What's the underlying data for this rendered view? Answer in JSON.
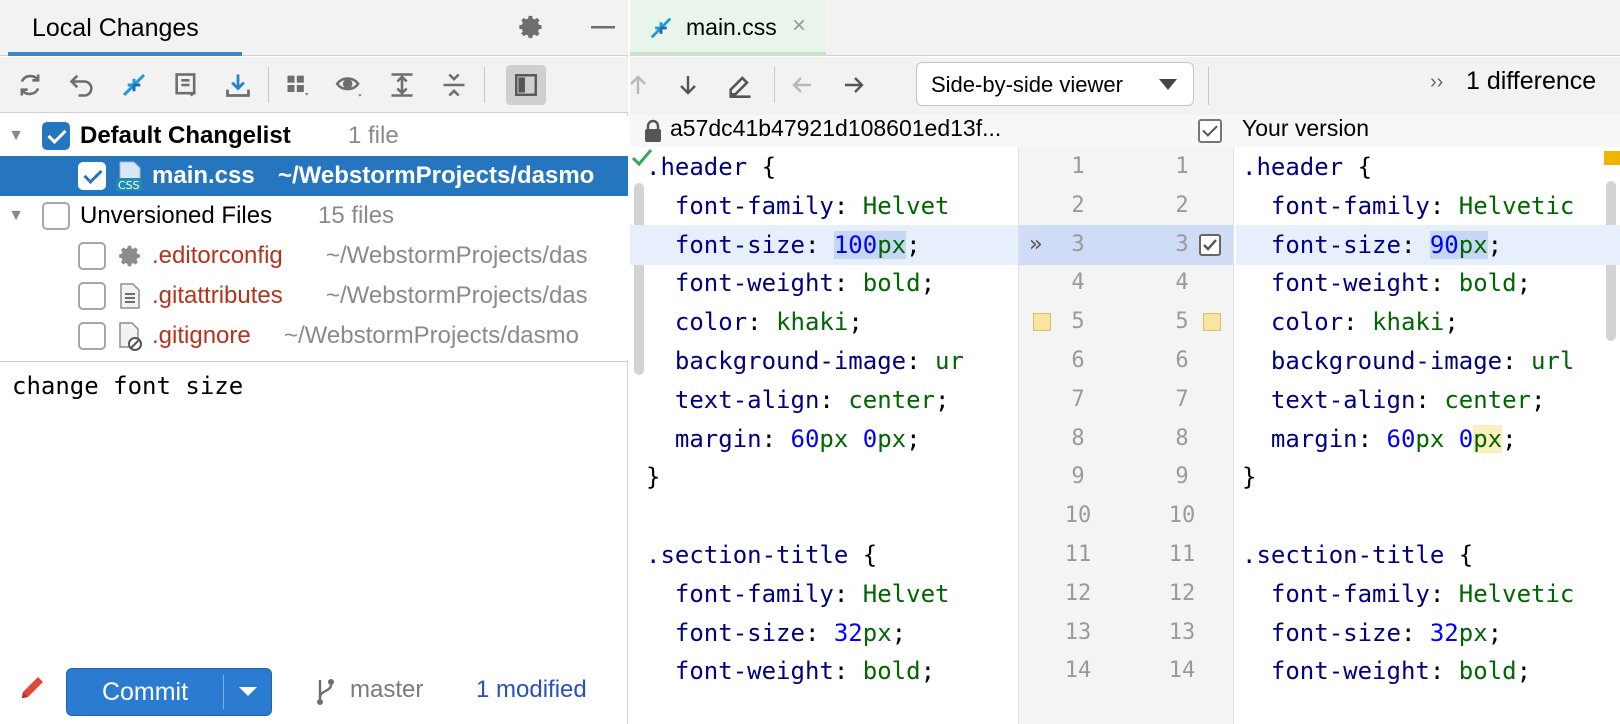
{
  "left_panel": {
    "title": "Local Changes",
    "header_icons": [
      "gear-icon",
      "minimize-icon"
    ],
    "toolbar": [
      "refresh-icon",
      "rollback-icon",
      "diff-icon",
      "shelve-icon",
      "update-icon",
      "group-by-icon",
      "view-options-icon",
      "expand-all-icon",
      "collapse-all-icon",
      "preview-toggle-icon"
    ],
    "tree": {
      "default": {
        "label": "Default Changelist",
        "count": "1 file",
        "checked": true
      },
      "default_files": [
        {
          "name": "main.css",
          "path": "~/WebstormProjects/dasmo",
          "checked": true,
          "selected": true
        }
      ],
      "unversioned": {
        "label": "Unversioned Files",
        "count": "15 files",
        "checked": false
      },
      "unversioned_files": [
        {
          "name": ".editorconfig",
          "path": "~/WebstormProjects/das",
          "icon": "gear-file-icon"
        },
        {
          "name": ".gitattributes",
          "path": "~/WebstormProjects/das",
          "icon": "text-file-icon"
        },
        {
          "name": ".gitignore",
          "path": "~/WebstormProjects/dasmo",
          "icon": "ignore-file-icon"
        }
      ]
    },
    "commit_message": "change font size",
    "commit_button": "Commit",
    "branch": "master",
    "modified": "1 modified"
  },
  "diff": {
    "tab": {
      "label": "main.css",
      "close": "×"
    },
    "viewer_mode": "Side-by-side viewer",
    "differences_chevron": "››",
    "differences": "1 difference",
    "left_revision": "a57dc41b47921d108601ed13f...",
    "right_title": "Your version",
    "left_lines": [
      ".header {",
      "  font-family: Helvet",
      "  font-size: 100px;",
      "  font-weight: bold;",
      "  color: khaki;",
      "  background-image: ur",
      "  text-align: center;",
      "  margin: 60px 0px;",
      "}",
      "",
      ".section-title {",
      "  font-family: Helvet",
      "  font-size: 32px;",
      "  font-weight: bold;"
    ],
    "right_lines": [
      ".header {",
      "  font-family: Helvetic",
      "  font-size: 90px;",
      "  font-weight: bold;",
      "  color: khaki;",
      "  background-image: url",
      "  text-align: center;",
      "  margin: 60px 0px;",
      "}",
      "",
      ".section-title {",
      "  font-family: Helvetic",
      "  font-size: 32px;",
      "  font-weight: bold;"
    ],
    "line_numbers": [
      "1",
      "2",
      "3",
      "4",
      "5",
      "6",
      "7",
      "8",
      "9",
      "10",
      "11",
      "12",
      "13",
      "14"
    ],
    "changed_line": 3,
    "colors": {
      "accent": "#2675bf",
      "changed_line": "#e7eefc",
      "gutter_changed": "#cfdcf5",
      "marker": "#f7e6a0"
    }
  }
}
